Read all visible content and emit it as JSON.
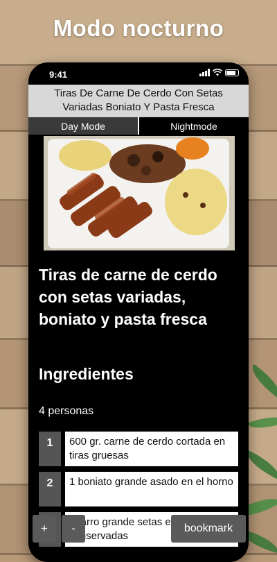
{
  "promo_title": "Modo nocturno",
  "status_bar": {
    "time": "9:41"
  },
  "header": {
    "title": "Tiras De Carne De Cerdo Con Setas Variadas Boniato Y Pasta Fresca"
  },
  "mode_tabs": {
    "day": "Day Mode",
    "night": "Nightmode",
    "selected": "night"
  },
  "recipe": {
    "title": "Tiras de carne de cerdo con setas variadas, boniato y pasta fresca",
    "ingredients_heading": "Ingredientes",
    "servings": "4 personas",
    "ingredients": [
      {
        "num": "1",
        "text": "600 gr. carne de cerdo cortada en tiras gruesas"
      },
      {
        "num": "2",
        "text": "1 boniato grande asado en el horno"
      },
      {
        "num": "3",
        "text": "1 tarro grande setas en conservadas"
      }
    ]
  },
  "controls": {
    "plus": "+",
    "minus": "-",
    "bookmark": "bookmark"
  },
  "colors": {
    "background_wood": "#b89a78",
    "phone": "#000000",
    "header_bg": "#d8d8d8",
    "button_bg": "#5a5a5a"
  }
}
